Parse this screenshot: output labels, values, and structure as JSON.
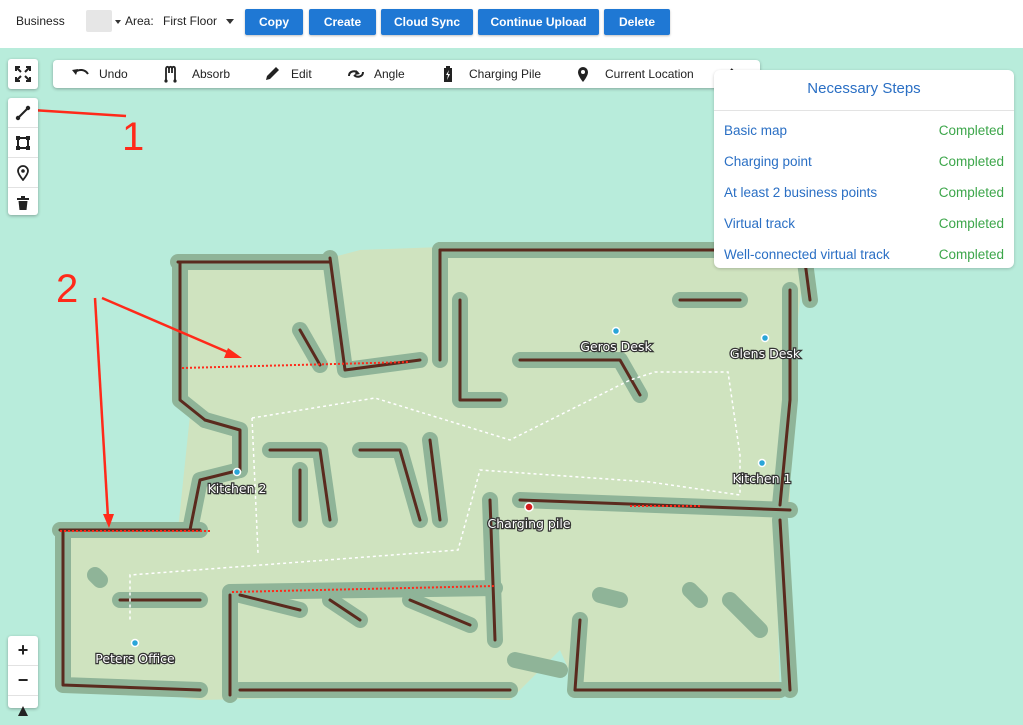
{
  "header": {
    "business_label": "Business",
    "area_label": "Area:",
    "area_value": "First Floor",
    "buttons": {
      "copy": "Copy",
      "create": "Create",
      "cloud_sync": "Cloud Sync",
      "continue_upload": "Continue Upload",
      "delete": "Delete"
    }
  },
  "edit_toolbar": {
    "undo": "Undo",
    "absorb": "Absorb",
    "edit": "Edit",
    "angle": "Angle",
    "charging_pile": "Charging Pile",
    "current_location": "Current Location"
  },
  "left_tools": [
    "fullscreen-icon",
    "draw-line-icon",
    "draw-rectangle-icon",
    "location-pin-icon",
    "trash-icon"
  ],
  "necessary_steps": {
    "title": "Necessary Steps",
    "items": [
      {
        "name": "Basic map",
        "status": "Completed"
      },
      {
        "name": "Charging point",
        "status": "Completed"
      },
      {
        "name": "At least 2 business points",
        "status": "Completed"
      },
      {
        "name": "Virtual track",
        "status": "Completed"
      },
      {
        "name": "Well-connected virtual track",
        "status": "Completed"
      }
    ]
  },
  "map": {
    "points": {
      "geros_desk": "Geros Desk",
      "glens_desk": "Glens Desk",
      "kitchen_2": "Kitchen 2",
      "kitchen_1": "Kitchen 1",
      "charging_pile": "Charging pile",
      "peters_office": "Peters Office"
    }
  },
  "annotations": {
    "marker_1": "1",
    "marker_2": "2"
  },
  "zoom": {
    "in": "+",
    "out": "−"
  },
  "colors": {
    "primary_button": "#1f78d4",
    "map_background": "#b8ecdb",
    "floor": "#cfe3bf",
    "wall_buffer": "#8fb498",
    "wall": "#5a2a1e",
    "virtual_wall": "#ff2a1a",
    "annotation": "#ff2a1a",
    "status_completed": "#3ca64a",
    "link_blue": "#2a6fc4"
  }
}
